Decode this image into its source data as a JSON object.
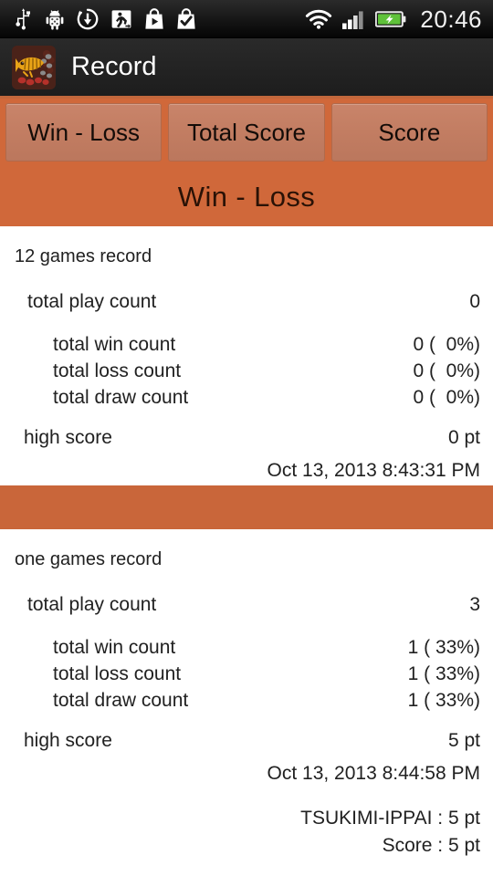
{
  "statusbar": {
    "icons": [
      "usb-icon",
      "android-debug-icon",
      "download-sync-icon",
      "running-man-icon",
      "play-store-icon",
      "checkmark-bag-icon"
    ],
    "wifi": "wifi-icon",
    "signal": "signal-bars-icon",
    "battery": "battery-charging-icon",
    "clock": "20:46"
  },
  "actionbar": {
    "app_icon": "grilled-fish-icon",
    "title": "Record"
  },
  "tabs": [
    {
      "label": "Win - Loss",
      "selected": true
    },
    {
      "label": "Total Score",
      "selected": false
    },
    {
      "label": "Score",
      "selected": false
    }
  ],
  "page_title": "Win - Loss",
  "sections": [
    {
      "heading": "12 games record",
      "play_count_label": "total play count",
      "play_count_value": "0",
      "win_label": "total win count",
      "win_value": "0 (  0%)",
      "loss_label": "total loss count",
      "loss_value": "0 (  0%)",
      "draw_label": "total draw count",
      "draw_value": "0 (  0%)",
      "high_score_label": "high score",
      "high_score_value": "0 pt",
      "high_score_date": "Oct 13, 2013 8:43:31 PM",
      "details": []
    },
    {
      "heading": "one games record",
      "play_count_label": "total play count",
      "play_count_value": "3",
      "win_label": "total win count",
      "win_value": "1 ( 33%)",
      "loss_label": "total loss count",
      "loss_value": "1 ( 33%)",
      "draw_label": "total draw count",
      "draw_value": "1 ( 33%)",
      "high_score_label": "high score",
      "high_score_value": "5 pt",
      "high_score_date": "Oct 13, 2013 8:44:58 PM",
      "details": [
        "TSUKIMI-IPPAI : 5 pt",
        "Score : 5 pt"
      ]
    }
  ],
  "colors": {
    "accent_orange": "#d0683a",
    "band_orange": "#c9663a",
    "tab_fill": "#c27d62",
    "actionbar": "#222222",
    "text": "#212121"
  }
}
